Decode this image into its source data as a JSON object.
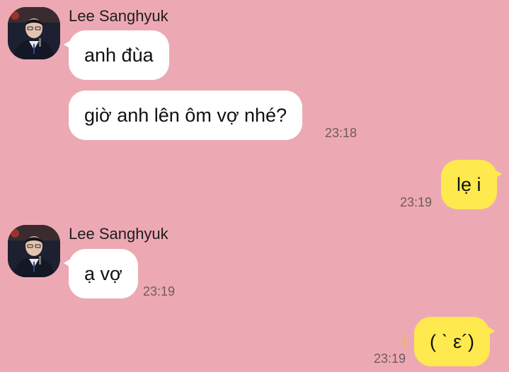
{
  "colors": {
    "background": "#eda9b3",
    "incoming_bubble": "#ffffff",
    "outgoing_bubble": "#fee94e",
    "unread_count": "#e8c21a"
  },
  "messages": [
    {
      "sender": "Lee Sanghyuk",
      "texts": [
        "anh đùa",
        "giờ anh lên ôm vợ nhé?"
      ],
      "time": "23:18"
    },
    {
      "sender": "me",
      "texts": [
        "lẹ i"
      ],
      "time": "23:19"
    },
    {
      "sender": "Lee Sanghyuk",
      "texts": [
        "ạ vợ"
      ],
      "time": "23:19"
    },
    {
      "sender": "me",
      "texts": [
        "( ˋ ε´)"
      ],
      "time": "23:19",
      "unread": "1"
    }
  ]
}
